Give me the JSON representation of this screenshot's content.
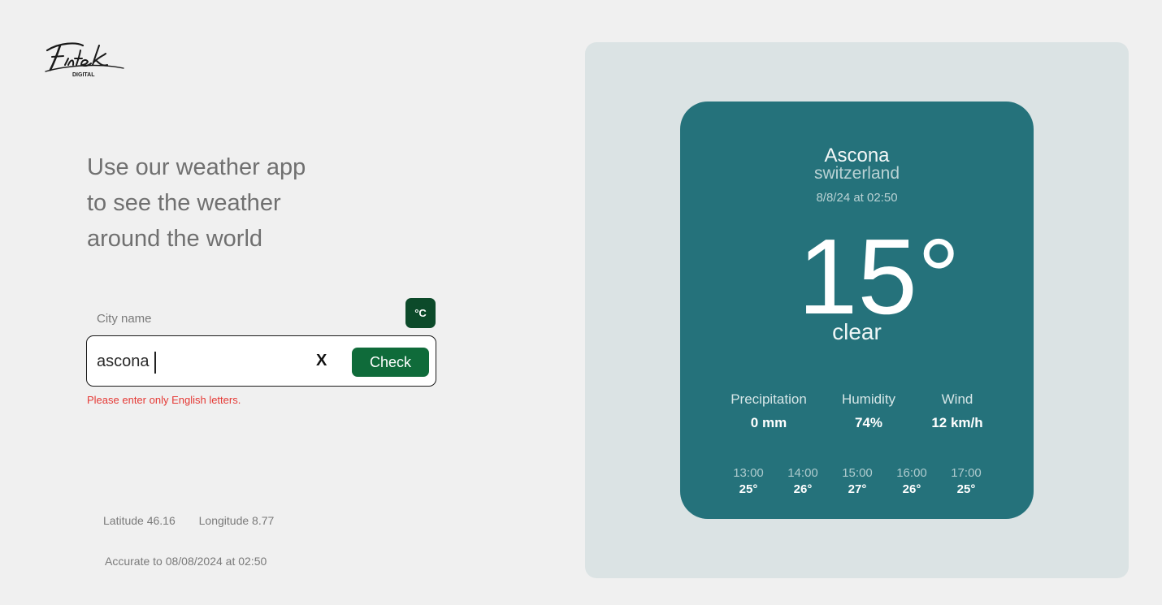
{
  "brand": {
    "logo_text": "Fintek",
    "logo_subtext": "DIGITAL"
  },
  "headline": {
    "lines": [
      "Use our weather app",
      "to see the weather",
      "around the world"
    ]
  },
  "search": {
    "label": "City name",
    "value": "ascona",
    "clear_label": "X",
    "submit_label": "Check",
    "unit_toggle_label": "°C",
    "error": "Please enter only English letters."
  },
  "location": {
    "latitude_label": "Latitude 46.16",
    "longitude_label": "Longitude 8.77",
    "accuracy": "Accurate to 08/08/2024 at 02:50"
  },
  "weather": {
    "city": "Ascona",
    "country": "switzerland",
    "datetime": "8/8/24 at 02:50",
    "temperature": "15°",
    "condition": "clear",
    "stats": [
      {
        "label": "Precipitation",
        "value": "0 mm"
      },
      {
        "label": "Humidity",
        "value": "74%"
      },
      {
        "label": "Wind",
        "value": "12 km/h"
      }
    ],
    "hourly": [
      {
        "time": "13:00",
        "temp": "25°"
      },
      {
        "time": "14:00",
        "temp": "26°"
      },
      {
        "time": "15:00",
        "temp": "27°"
      },
      {
        "time": "16:00",
        "temp": "26°"
      },
      {
        "time": "17:00",
        "temp": "25°"
      }
    ]
  },
  "colors": {
    "card": "#25727b",
    "panel": "#dbe3e4",
    "check_button": "#0f6b3a",
    "unit_button": "#0c4a2a",
    "error": "#e53935"
  }
}
